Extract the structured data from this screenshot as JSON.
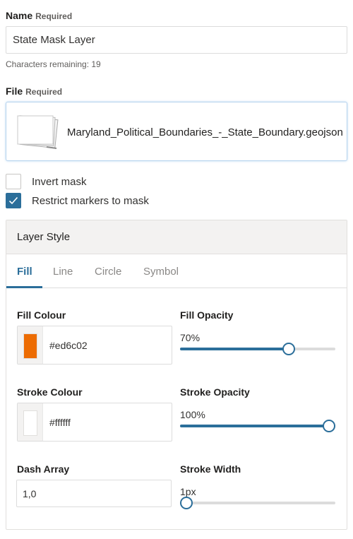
{
  "name": {
    "label": "Name",
    "required": "Required",
    "value": "State Mask Layer",
    "chars_remaining": "Characters remaining: 19"
  },
  "file": {
    "label": "File",
    "required": "Required",
    "filename": "Maryland_Political_Boundaries_-_State_Boundary.geojson"
  },
  "options": {
    "invert_mask": {
      "label": "Invert mask",
      "checked": false
    },
    "restrict_markers": {
      "label": "Restrict markers to mask",
      "checked": true
    }
  },
  "layer_style": {
    "title": "Layer Style",
    "tabs": [
      {
        "label": "Fill",
        "active": true
      },
      {
        "label": "Line",
        "active": false
      },
      {
        "label": "Circle",
        "active": false
      },
      {
        "label": "Symbol",
        "active": false
      }
    ],
    "fill_colour": {
      "label": "Fill Colour",
      "value": "#ed6c02",
      "color": "#ed6c02"
    },
    "fill_opacity": {
      "label": "Fill Opacity",
      "display": "70%",
      "value": 0.7
    },
    "stroke_colour": {
      "label": "Stroke Colour",
      "value": "#ffffff",
      "color": "#ffffff"
    },
    "stroke_opacity": {
      "label": "Stroke Opacity",
      "display": "100%",
      "value": 1.0
    },
    "dash_array": {
      "label": "Dash Array",
      "value": "1,0"
    },
    "stroke_width": {
      "label": "Stroke Width",
      "display": "1px",
      "value": 0
    }
  },
  "colors": {
    "accent": "#2b6e9a"
  }
}
